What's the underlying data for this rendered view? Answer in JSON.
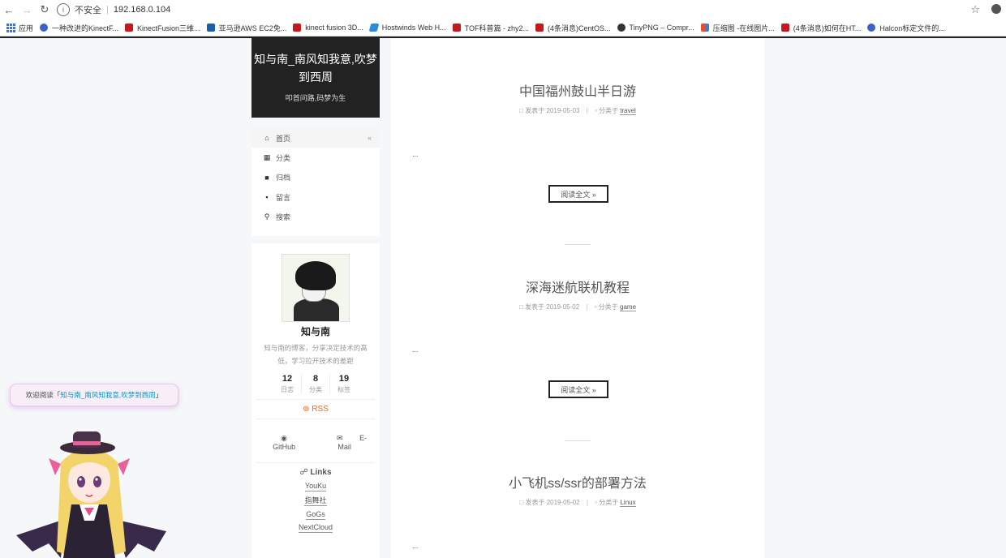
{
  "browser": {
    "insecure_label": "不安全",
    "url": "192.168.0.104",
    "bookmarks": [
      {
        "icon": "apps-icon",
        "label": "应用"
      },
      {
        "icon": "paw-icon",
        "label": "一种改进的KinectF..."
      },
      {
        "icon": "csdn-icon",
        "label": "KinectFusion三维..."
      },
      {
        "icon": "bing-icon",
        "label": "亚马逊AWS EC2免..."
      },
      {
        "icon": "csdn-icon",
        "label": "kinect fusion 3D..."
      },
      {
        "icon": "hostwinds-icon",
        "label": "Hostwinds Web H..."
      },
      {
        "icon": "csdn-icon",
        "label": "TOF科普篇 - zhy2..."
      },
      {
        "icon": "csdn-icon",
        "label": "(4条消息)CentOS..."
      },
      {
        "icon": "tinypng-icon",
        "label": "TinyPNG – Compr..."
      },
      {
        "icon": "compress-icon",
        "label": "压缩图 -在线图片..."
      },
      {
        "icon": "csdn-icon",
        "label": "(4条消息)如何在HT..."
      },
      {
        "icon": "paw-icon",
        "label": "Halcon标定文件的..."
      }
    ]
  },
  "site": {
    "title": "知与南_南风知我意,吹梦到西周",
    "subtitle": "叩首问路,码梦为生"
  },
  "menu": [
    {
      "icon": "home-icon",
      "glyph": "⌂",
      "label": "首页",
      "active": true
    },
    {
      "icon": "grid-icon",
      "glyph": "⋮⋮",
      "label": "分类"
    },
    {
      "icon": "archive-icon",
      "glyph": "▪",
      "label": "归档"
    },
    {
      "icon": "comment-icon",
      "glyph": "▬",
      "label": "留言"
    },
    {
      "icon": "search-icon",
      "glyph": "⚲",
      "label": "搜索"
    }
  ],
  "menu_active_marker": "«",
  "profile": {
    "name": "知与南",
    "description": "知与南的博客，分享决定技术的高低，学习拉开技术的差距",
    "stats": [
      {
        "count": "12",
        "label": "日志"
      },
      {
        "count": "8",
        "label": "分类"
      },
      {
        "count": "19",
        "label": "标签"
      }
    ],
    "rss": "RSS",
    "github": "GitHub",
    "email": "E-Mail",
    "links_title": "Links",
    "links": [
      "YouKu",
      "指舞社",
      "GoGs",
      "NextCloud"
    ]
  },
  "posts": [
    {
      "title": "中国福州鼓山半日游",
      "posted_label": "发表于",
      "date": "2019-05-03",
      "category_label": "分类于",
      "category": "travel",
      "excerpt": "...",
      "read_more": "阅读全文 »"
    },
    {
      "title": "深海迷航联机教程",
      "posted_label": "发表于",
      "date": "2019-05-02",
      "category_label": "分类于",
      "category": "game",
      "excerpt": "...",
      "read_more": "阅读全文 »"
    },
    {
      "title": "小飞机ss/ssr的部署方法",
      "posted_label": "发表于",
      "date": "2019-05-02",
      "category_label": "分类于",
      "category": "Linux",
      "excerpt": "..."
    }
  ],
  "widget": {
    "tip_prefix": "欢迎阅读「",
    "tip_highlight": "知与南_南风知我意,吹梦到西周",
    "tip_suffix": "」"
  },
  "colors": {
    "brand_bg": "#222222",
    "rss": "#fc6423",
    "link_highlight": "#0099cc"
  }
}
